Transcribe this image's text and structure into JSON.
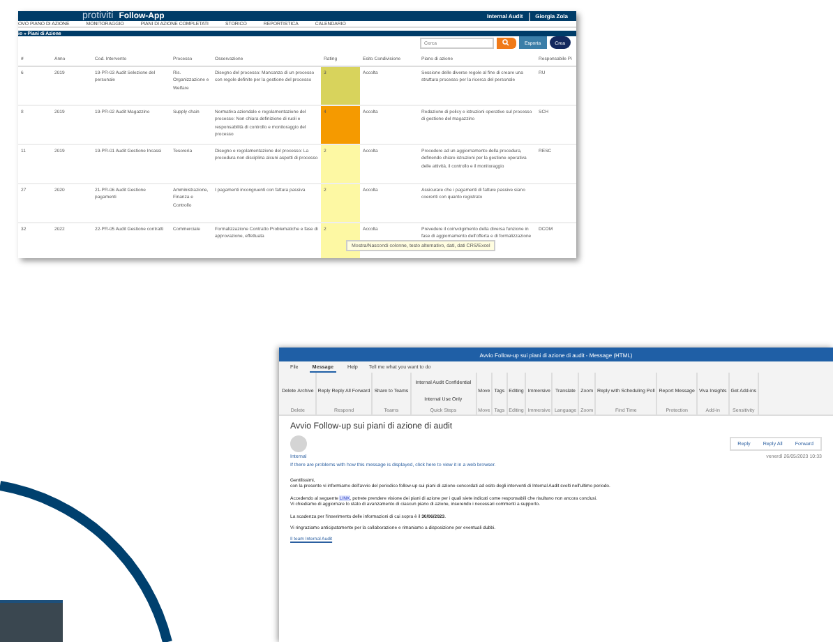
{
  "web_app": {
    "brand": "protiviti",
    "app_name": "Follow-App",
    "area": "Internal Audit",
    "user": "Giorgia Zola",
    "nav": [
      {
        "label": "OVO PIANO DI AZIONE"
      },
      {
        "label": "MONITORAGGIO"
      },
      {
        "label": "PIANI DI AZIONE COMPLETATI"
      },
      {
        "label": "STORICO"
      },
      {
        "label": "REPORTISTICA"
      },
      {
        "label": "CALENDARIO"
      }
    ],
    "breadcrumb": "io » Piani di Azione",
    "search": {
      "placeholder": "Cerca"
    },
    "buttons": [
      {
        "label": "Esporta",
        "kind": "export"
      },
      {
        "label": "Crea",
        "kind": "create"
      }
    ],
    "table": {
      "columns": [
        "#",
        "Anno",
        "Cod. Intervento",
        "Processo",
        "Osservazione",
        "Rating",
        "Esito Condivisione",
        "Piano di azione",
        "Responsabile Pi"
      ],
      "rows": [
        {
          "cells": [
            "6",
            "2019",
            "19-PR-03 Audit Selezione del personale",
            "Ris. Organizzazione e Welfare",
            "Disegno del processo: Mancanza di un processo con regole definite per la gestione del processo",
            "3",
            "Accolta",
            "Sessione delle diverse regole al fine di creare una struttura processo per la ricerca del personale",
            "RU"
          ],
          "color": "#d8d35c"
        },
        {
          "cells": [
            "8",
            "2019",
            "19-PR-02 Audit Magazzino",
            "Supply chain",
            "Normativa aziendale e regolamentazione del processo: Non chiara definizione di ruoli e responsabilità di controllo e monitoraggio del processo",
            "4",
            "Accolta",
            "Redazione di policy e istruzioni operative sul processo di gestione del magazzino",
            "SCH"
          ],
          "color": "#f59a00"
        },
        {
          "cells": [
            "11",
            "2019",
            "19-PR-01 Audit Gestione Incassi",
            "Tesoreria",
            "Disegno e regolamentazione del processo: La procedura non disciplina alcuni aspetti di processo",
            "2",
            "Accolta",
            "Procedere ad un aggiornamento della procedura, definendo chiare istruzioni per la gestione operativa delle attività, il controllo e il monitoraggio",
            "RESC"
          ],
          "color": "#fdf8a3"
        },
        {
          "cells": [
            "27",
            "2020",
            "21-PR-06 Audit Gestione pagamenti",
            "Amministrazione, Finanza e Controllo",
            "I pagamenti incongruenti con fattura passiva",
            "2",
            "Accolta",
            "Assicurare che i pagamenti di fatture passive siano coerenti con quanto registrato",
            ""
          ],
          "color": "#fdf8a3"
        },
        {
          "cells": [
            "32",
            "2022",
            "22-PR-05 Audit Gestione contratti",
            "Commerciale",
            "Formalizzazione Contratto Problematiche e fase di approvazione, effettuata",
            "2",
            "Accolta",
            "Prevedere il coinvolgimento della diversa funzione in fase di aggiornamento dell'offerta e di formalizzazione",
            "DCOM"
          ],
          "color": "#fdf8a3"
        }
      ]
    },
    "tooltip": "Mostra/Nascondi colonne, testo alternativo, dati, dati CRS/Excel"
  },
  "mail": {
    "title": "Avvio Follow-up sui piani di azione di audit - Message (HTML)",
    "tabs": [
      {
        "label": "File",
        "selected": false
      },
      {
        "label": "Message",
        "selected": true
      },
      {
        "label": "Help",
        "selected": false
      }
    ],
    "tell_me": "Tell me what you want to do",
    "ribbon": [
      {
        "label": "Delete",
        "buttons": [
          "Delete",
          "Archive"
        ]
      },
      {
        "label": "Respond",
        "buttons": [
          "Reply",
          "Reply All",
          "Forward"
        ]
      },
      {
        "label": "Teams",
        "buttons": [
          "Share to Teams"
        ]
      },
      {
        "label": "Quick Steps",
        "buttons": [
          "Internal Audit",
          "Confidential",
          "Internal Use Only"
        ]
      },
      {
        "label": "Move",
        "buttons": [
          "Move"
        ]
      },
      {
        "label": "Tags",
        "buttons": [
          "Tags"
        ]
      },
      {
        "label": "Editing",
        "buttons": [
          "Editing"
        ]
      },
      {
        "label": "Immersive",
        "buttons": [
          "Immersive"
        ]
      },
      {
        "label": "Language",
        "buttons": [
          "Translate"
        ]
      },
      {
        "label": "Zoom",
        "buttons": [
          "Zoom"
        ]
      },
      {
        "label": "Find Time",
        "buttons": [
          "Reply with Scheduling Poll"
        ]
      },
      {
        "label": "Protection",
        "buttons": [
          "Report Message"
        ]
      },
      {
        "label": "Add-in",
        "buttons": [
          "Viva Insights"
        ]
      },
      {
        "label": "Sensitivity",
        "buttons": [
          "Get Add-ins"
        ]
      }
    ],
    "subject": "Avvio Follow-up sui piani di azione di audit",
    "sender": "Internal",
    "info": "If there are problems with how this message is displayed, click here to view it in a web browser.",
    "actions": [
      "Reply",
      "Reply All",
      "Forward"
    ],
    "date": "venerdì 26/05/2023 10:33",
    "body": [
      {
        "kind": "text",
        "text": "Gentilissimi,"
      },
      {
        "kind": "text",
        "text": "con la presente vi informiamo dell'avvio del periodico follow-up sui piani di azione concordati ad esito degli interventi di Internal Audit svolti nell'ultimo periodo."
      },
      {
        "kind": "gap"
      },
      {
        "kind": "link",
        "before": "Accedendo al seguente ",
        "link": "LINK",
        "after": ", potrete prendere visione dei piani di azione per i quali siete indicati come responsabili che risultano non ancora conclusi."
      },
      {
        "kind": "text",
        "text": "Vi chiediamo di aggiornare lo stato di avanzamento di ciascun piano di azione, inserendo i necessari commenti a supporto."
      },
      {
        "kind": "gap"
      },
      {
        "kind": "text",
        "text": "La scadenza per l'inserimento delle informazioni di cui sopra è il **30/06/2023**."
      },
      {
        "kind": "gap"
      },
      {
        "kind": "text",
        "text": "Vi ringraziamo anticipatamente per la collaborazione e rimaniamo a disposizione per eventuali dubbi."
      },
      {
        "kind": "gap"
      },
      {
        "kind": "signature",
        "text": "Il team Internal Audit"
      }
    ]
  }
}
